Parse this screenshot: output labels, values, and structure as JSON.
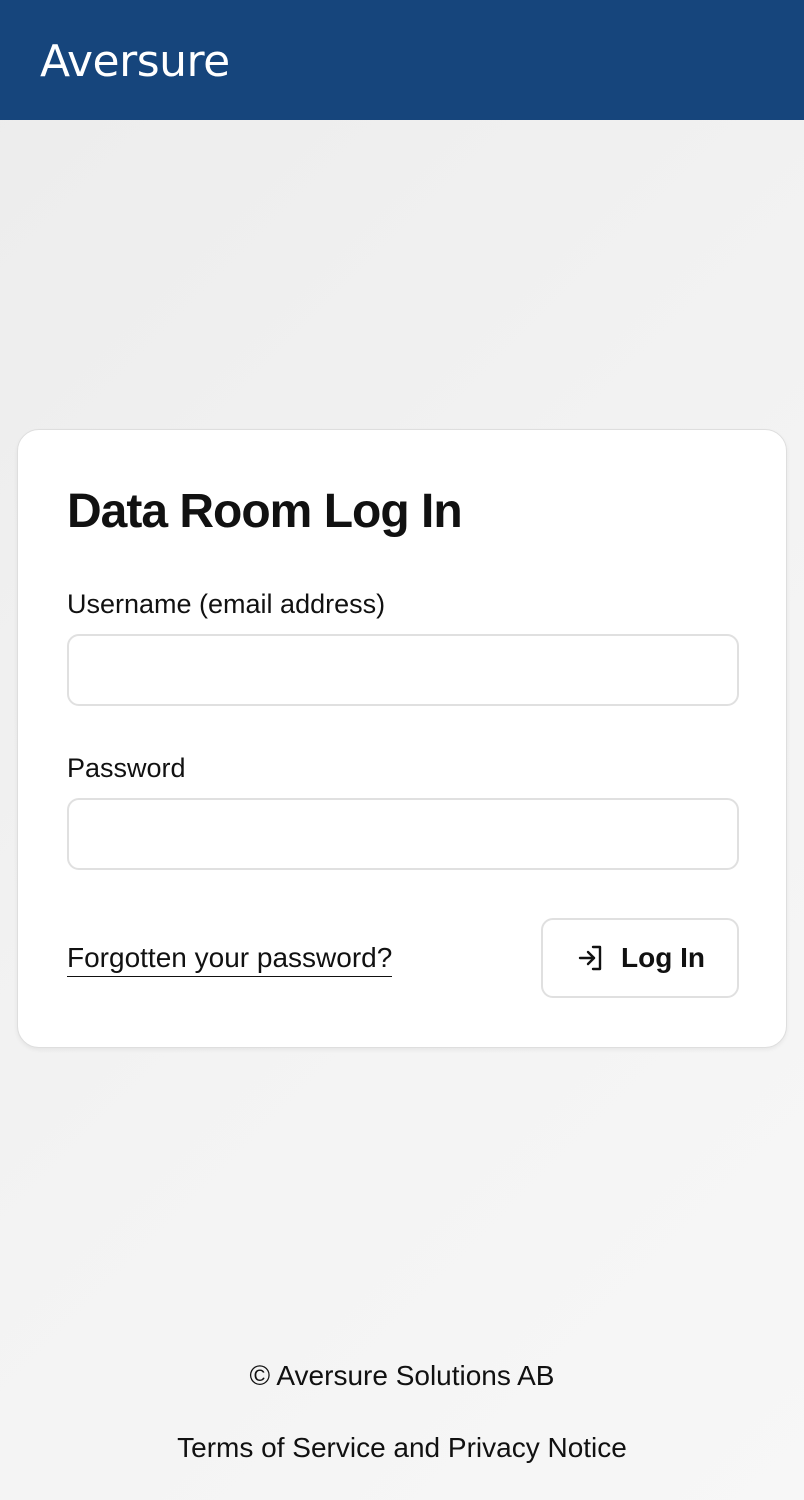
{
  "header": {
    "logo_text": "Aversure",
    "background_color": "#16457c"
  },
  "login_card": {
    "title": "Data Room Log In",
    "username": {
      "label": "Username (email address)",
      "value": "",
      "placeholder": ""
    },
    "password": {
      "label": "Password",
      "value": "",
      "placeholder": ""
    },
    "forgot_password_link": "Forgotten your password?",
    "login_button": {
      "label": "Log In",
      "icon": "login-arrow-icon"
    }
  },
  "footer": {
    "copyright": "© Aversure Solutions AB",
    "terms_link": "Terms of Service and Privacy Notice"
  }
}
